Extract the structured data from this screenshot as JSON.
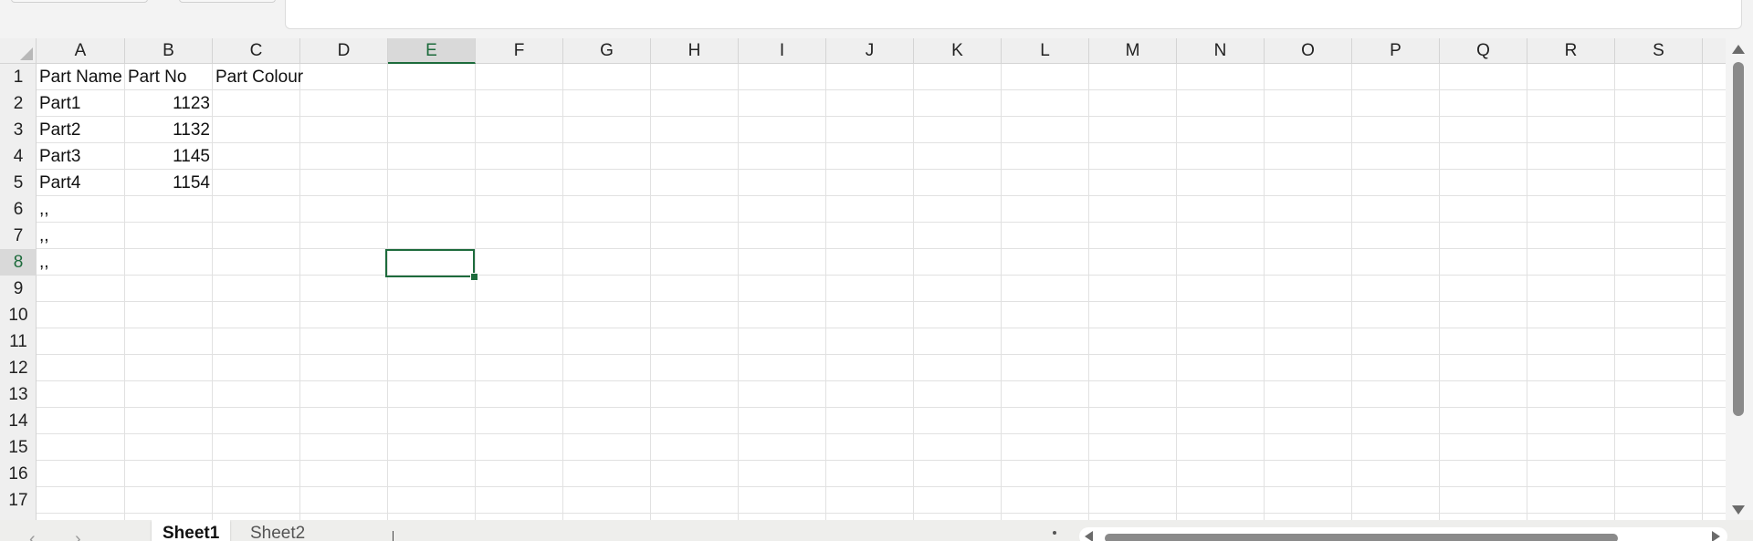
{
  "spreadsheet": {
    "columns": [
      "A",
      "B",
      "C",
      "D",
      "E",
      "F",
      "G",
      "H",
      "I",
      "J",
      "K",
      "L",
      "M",
      "N",
      "O",
      "P",
      "Q",
      "R",
      "S"
    ],
    "rows": [
      "1",
      "2",
      "3",
      "4",
      "5",
      "6",
      "7",
      "8",
      "9",
      "10",
      "11",
      "12",
      "13",
      "14",
      "15",
      "16",
      "17"
    ],
    "selected_column": "E",
    "selected_row": "8",
    "cells": {
      "A1": "Part Name",
      "B1": "Part No",
      "C1": "Part Colour",
      "A2": "Part1",
      "B2": "1123",
      "A3": "Part2",
      "B3": "1132",
      "A4": "Part3",
      "B4": "1145",
      "A5": "Part4",
      "B5": "1154",
      "A6": ",,",
      "A7": ",,",
      "A8": ",,"
    }
  },
  "tabs": {
    "active": "Sheet1",
    "inactive": "Sheet2"
  },
  "colors": {
    "accent": "#1d6b3c",
    "gridline": "#e1e1e1",
    "header_bg": "#efefef"
  }
}
